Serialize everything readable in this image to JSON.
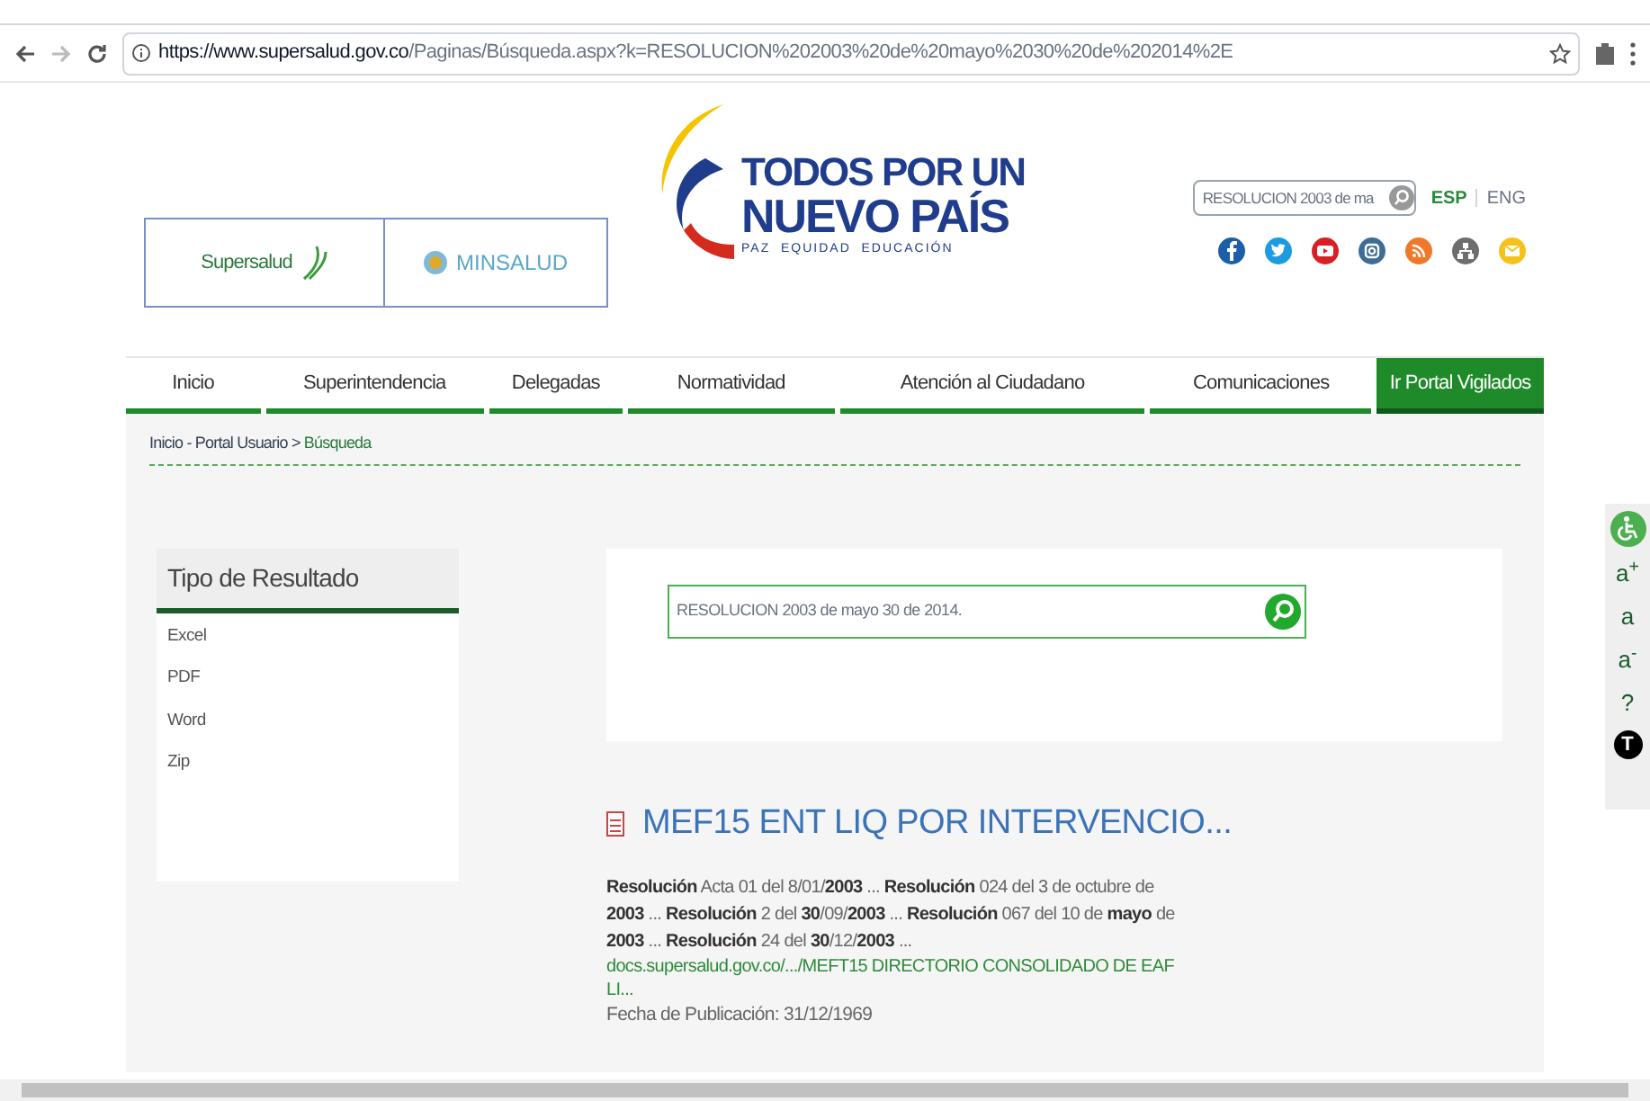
{
  "browser": {
    "url_host": "https://www.supersalud.gov.co",
    "url_path": "/Paginas/Búsqueda.aspx?k=RESOLUCION%202003%20de%20mayo%2030%20de%202014%2E"
  },
  "header": {
    "logo_left": "Supersalud",
    "logo_right": "MINSALUD",
    "slogan_line1": "TODOS POR UN",
    "slogan_line2": "NUEVO PAÍS",
    "slogan_sub": "PAZ  EQUIDAD  EDUCACIÓN",
    "search_value": "RESOLUCION 2003 de ma",
    "languages": [
      {
        "label": "ESP",
        "selected": true
      },
      {
        "label": "ENG",
        "selected": false
      }
    ],
    "social": [
      {
        "kind": "facebook",
        "color": "#1b5fa8"
      },
      {
        "kind": "twitter",
        "color": "#1d9be0"
      },
      {
        "kind": "youtube",
        "color": "#d81f26"
      },
      {
        "kind": "instagram",
        "color": "#3f6d96"
      },
      {
        "kind": "rss",
        "color": "#f0782a"
      },
      {
        "kind": "sitemap",
        "color": "#6d6d6d"
      },
      {
        "kind": "mail",
        "color": "#f5c21b"
      }
    ]
  },
  "nav": [
    {
      "label": "Inicio",
      "selected": false
    },
    {
      "label": "Superintendencia",
      "selected": false
    },
    {
      "label": "Delegadas",
      "selected": false
    },
    {
      "label": "Normatividad",
      "selected": false
    },
    {
      "label": "Atención al Ciudadano",
      "selected": false
    },
    {
      "label": "Comunicaciones",
      "selected": false
    },
    {
      "label": "Ir Portal Vigilados",
      "selected": true
    }
  ],
  "breadcrumb": {
    "trail": "Inicio - Portal Usuario",
    "separator": ">",
    "current": "Búsqueda"
  },
  "sidebar": {
    "title": "Tipo de Resultado",
    "items": [
      "Excel",
      "PDF",
      "Word",
      "Zip"
    ]
  },
  "search": {
    "value": "RESOLUCION 2003 de mayo 30 de 2014."
  },
  "result": {
    "title": "MEF15 ENT LIQ POR INTERVENCIO...",
    "snippet": "**Resolución** Acta 01 del 8/01/**2003** ... **Resolución** 024 del 3 de octubre de **2003** ... **Resolución** 2 del **30**/09/**2003** ... **Resolución** 067 del 10 de **mayo** de **2003** ... **Resolución** 24 del **30**/12/**2003** ...",
    "url": "docs.supersalud.gov.co/.../MEFT15 DIRECTORIO CONSOLIDADO DE EAF LI...",
    "date": "Fecha de Publicación: 31/12/1969"
  },
  "accessibility": [
    {
      "kind": "wheelchair"
    },
    {
      "kind": "text",
      "label": "a$^{+}$"
    },
    {
      "kind": "text",
      "label": "a"
    },
    {
      "kind": "text",
      "label": "a$^{-}$"
    },
    {
      "kind": "text",
      "label": "?"
    },
    {
      "kind": "badge",
      "label": "T"
    }
  ]
}
